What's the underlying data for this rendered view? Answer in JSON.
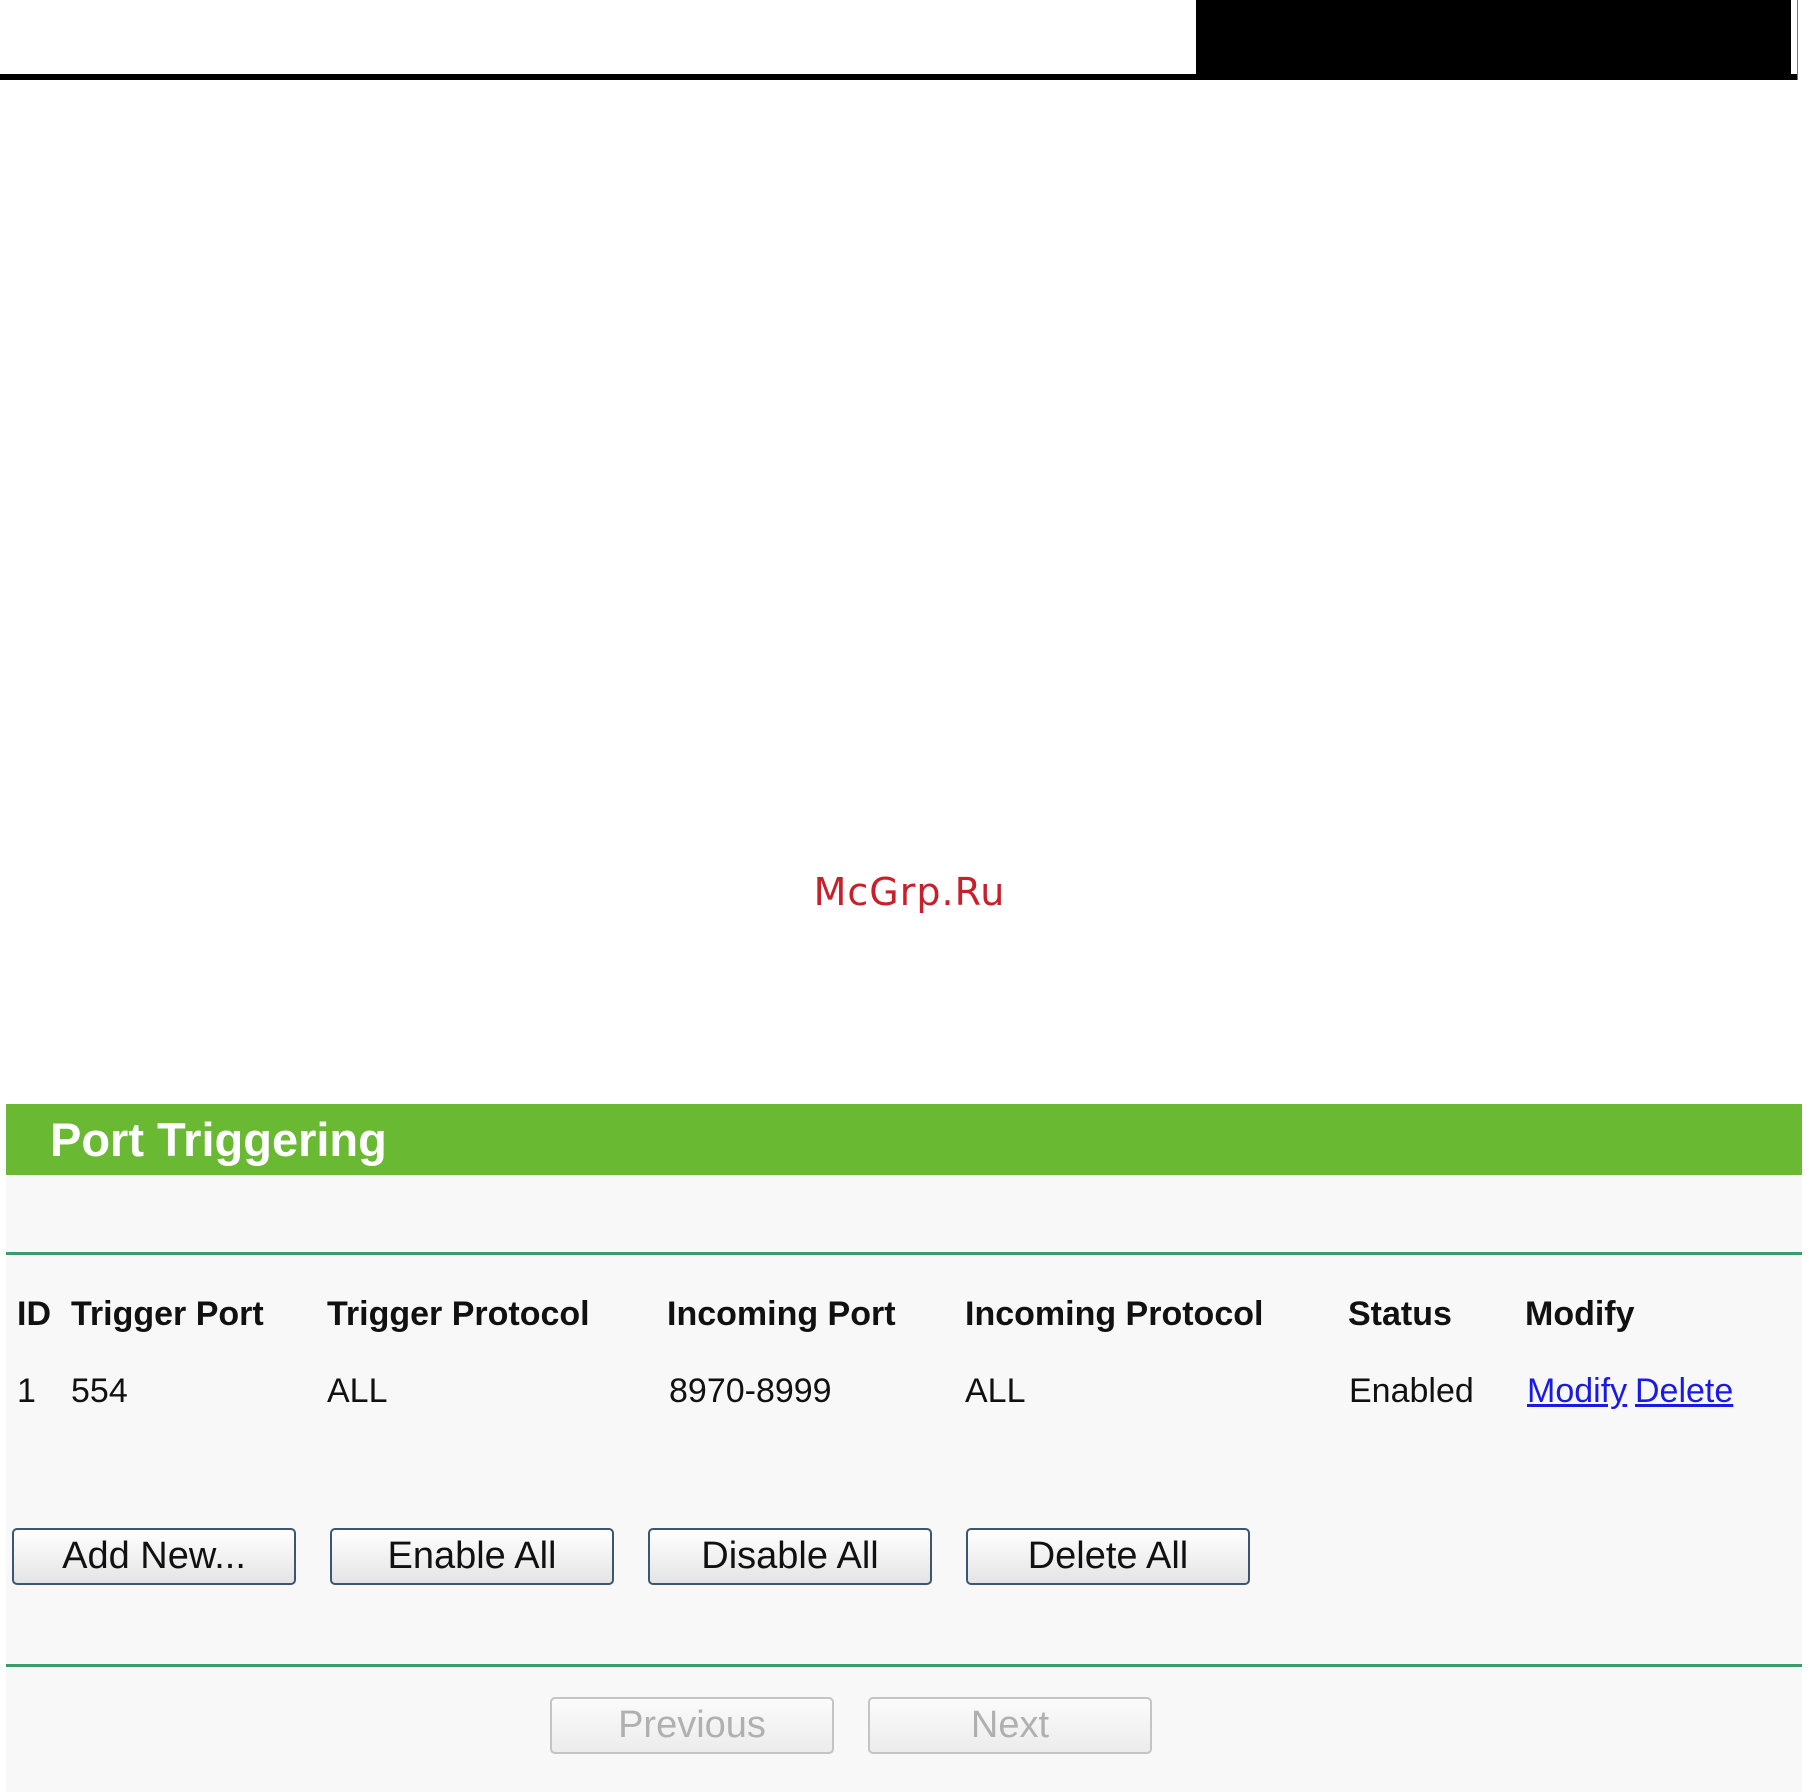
{
  "watermark": "McGrp.Ru",
  "panel": {
    "title": "Port Triggering"
  },
  "table": {
    "headers": [
      "ID",
      "Trigger Port",
      "Trigger Protocol",
      "Incoming Port",
      "Incoming Protocol",
      "Status",
      "Modify"
    ],
    "rows": [
      {
        "id": "1",
        "trigger_port": "554",
        "trigger_protocol": "ALL",
        "incoming_port": "8970-8999",
        "incoming_protocol": "ALL",
        "status": "Enabled",
        "modify_link": "Modify",
        "delete_link": "Delete"
      }
    ]
  },
  "actions": {
    "add_new": "Add New...",
    "enable_all": "Enable All",
    "disable_all": "Disable All",
    "delete_all": "Delete All"
  },
  "pagination": {
    "previous": "Previous",
    "next": "Next"
  },
  "colors": {
    "header_green": "#69b933",
    "rule_green": "#3d9a6a",
    "link_blue": "#1a1ae6",
    "watermark_red": "#c8202a"
  }
}
